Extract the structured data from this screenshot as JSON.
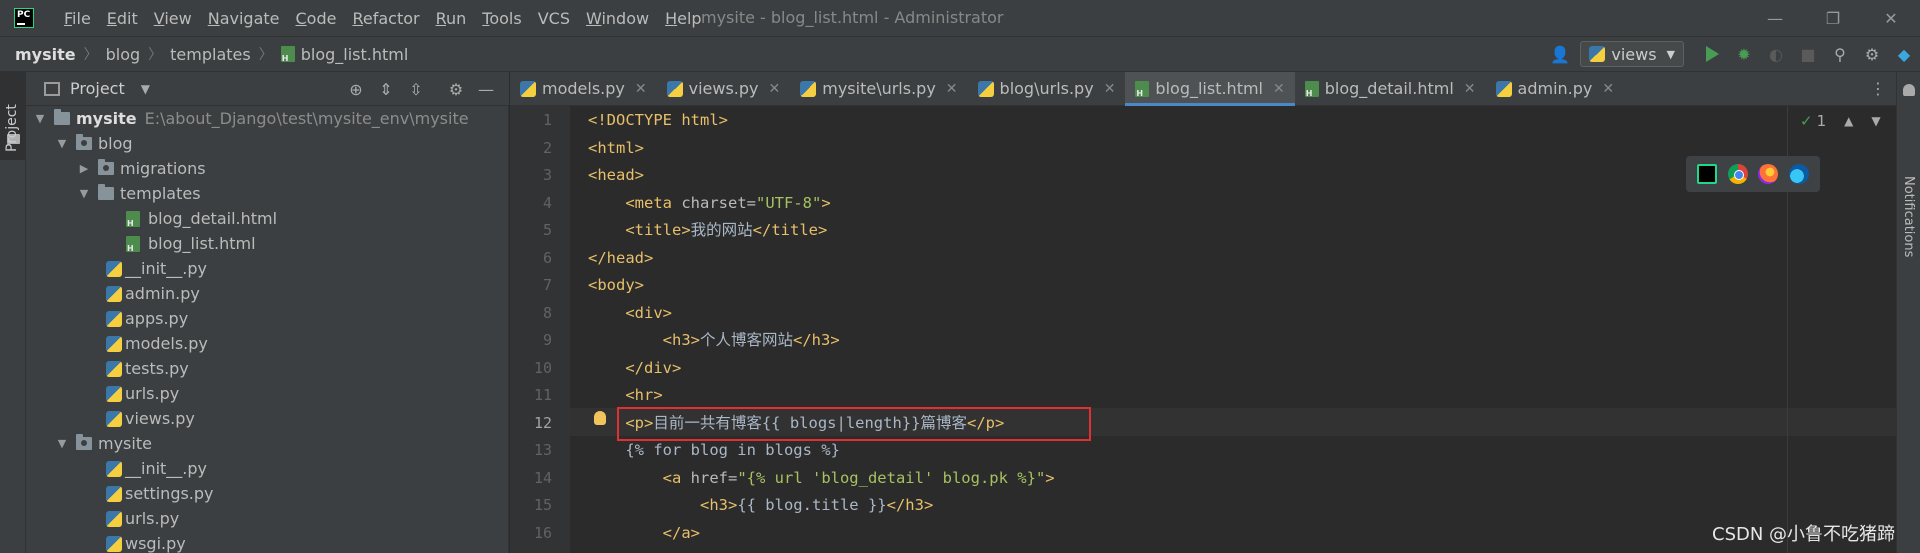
{
  "titlebar": {
    "menus": [
      {
        "label": "File",
        "mnemonic": "F",
        "rest": "ile"
      },
      {
        "label": "Edit",
        "mnemonic": "E",
        "rest": "dit"
      },
      {
        "label": "View",
        "mnemonic": "V",
        "rest": "iew"
      },
      {
        "label": "Navigate",
        "mnemonic": "N",
        "rest": "avigate"
      },
      {
        "label": "Code",
        "mnemonic": "C",
        "rest": "ode"
      },
      {
        "label": "Refactor",
        "mnemonic": "R",
        "rest": "efactor"
      },
      {
        "label": "Run",
        "mnemonic": "R",
        "rest": "un"
      },
      {
        "label": "Tools",
        "mnemonic": "T",
        "rest": "ools"
      },
      {
        "label": "VCS",
        "mnemonic": "",
        "rest": "VCS"
      },
      {
        "label": "Window",
        "mnemonic": "W",
        "rest": "indow"
      },
      {
        "label": "Help",
        "mnemonic": "H",
        "rest": "elp"
      }
    ],
    "window_title": "mysite - blog_list.html - Administrator"
  },
  "navbar": {
    "breadcrumbs": [
      "mysite",
      "blog",
      "templates",
      "blog_list.html"
    ],
    "run_config": "views"
  },
  "project": {
    "title": "Project",
    "tree": [
      {
        "name": "mysite",
        "path": "E:\\about_Django\\test\\mysite_env\\mysite",
        "type": "root"
      },
      {
        "name": "blog",
        "type": "pkg"
      },
      {
        "name": "migrations",
        "type": "pkg"
      },
      {
        "name": "templates",
        "type": "folder"
      },
      {
        "name": "blog_detail.html",
        "type": "html"
      },
      {
        "name": "blog_list.html",
        "type": "html"
      },
      {
        "name": "__init__.py",
        "type": "py"
      },
      {
        "name": "admin.py",
        "type": "py"
      },
      {
        "name": "apps.py",
        "type": "py"
      },
      {
        "name": "models.py",
        "type": "py"
      },
      {
        "name": "tests.py",
        "type": "py"
      },
      {
        "name": "urls.py",
        "type": "py"
      },
      {
        "name": "views.py",
        "type": "py"
      },
      {
        "name": "mysite",
        "type": "pkg"
      },
      {
        "name": "__init__.py",
        "type": "py"
      },
      {
        "name": "settings.py",
        "type": "py"
      },
      {
        "name": "urls.py",
        "type": "py"
      },
      {
        "name": "wsgi.py",
        "type": "py"
      }
    ]
  },
  "tabs": [
    {
      "label": "models.py",
      "type": "py"
    },
    {
      "label": "views.py",
      "type": "py"
    },
    {
      "label": "mysite\\urls.py",
      "type": "py"
    },
    {
      "label": "blog\\urls.py",
      "type": "py"
    },
    {
      "label": "blog_list.html",
      "type": "html",
      "active": true
    },
    {
      "label": "blog_detail.html",
      "type": "html"
    },
    {
      "label": "admin.py",
      "type": "py"
    }
  ],
  "editor": {
    "current_line": 12,
    "lines": [
      "1",
      "2",
      "3",
      "4",
      "5",
      "6",
      "7",
      "8",
      "9",
      "10",
      "11",
      "12",
      "13",
      "14",
      "15",
      "16"
    ],
    "inspection_count": "1"
  },
  "notifications_label": "Notifications",
  "sidebar_tab_label": "Project",
  "watermark": "CSDN @小鲁不吃猪蹄",
  "colors": {
    "highlight_box": "#e03030",
    "tag": "#e8bf6a",
    "string": "#a5c261",
    "active_tab_underline": "#4a88c7"
  }
}
